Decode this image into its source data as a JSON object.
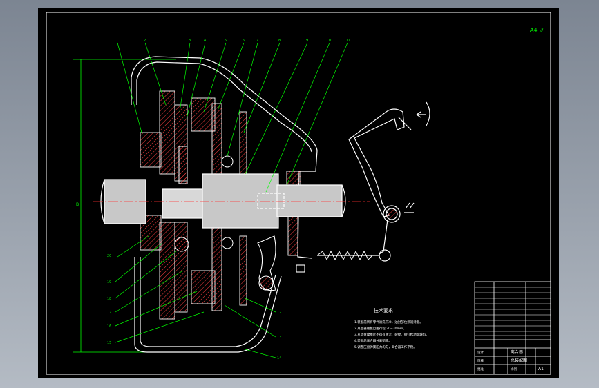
{
  "drawing": {
    "corner_mark": "A4 ↺",
    "part_numbers_top": [
      "1",
      "2",
      "3",
      "4",
      "5",
      "6",
      "7",
      "8",
      "9",
      "10",
      "11"
    ],
    "part_numbers_side": [
      "20",
      "19",
      "18",
      "17",
      "16",
      "15"
    ],
    "part_numbers_right": [
      "12",
      "13",
      "14"
    ],
    "dimension_label": "B",
    "tech_requirements": {
      "title": "技术要求",
      "lines": [
        "1.装配前所有零件清洗干净，油封部位涂润滑脂。",
        "2.离合器踏板自由行程 20~30mm。",
        "3.从动盘摩擦片不得有油污、裂纹、铆钉松动等缺陷。",
        "4.装配后离合器分离彻底。",
        "5.调整压盘弹簧压力均匀，离合器工作平稳。"
      ]
    },
    "title_block": {
      "drawing_name_line1": "离合器",
      "drawing_name_line2": "总装配图",
      "sheet_size": "A1",
      "label_scale": "比例",
      "label_design": "设计",
      "label_check": "审核",
      "label_approve": "批准"
    }
  },
  "colors": {
    "outline": "#ffffff",
    "leader": "#00ff00",
    "hatch": "#ff4040",
    "center_line": "#ff3030",
    "background": "#000000",
    "shaft_fill": "#d8d8d8"
  }
}
